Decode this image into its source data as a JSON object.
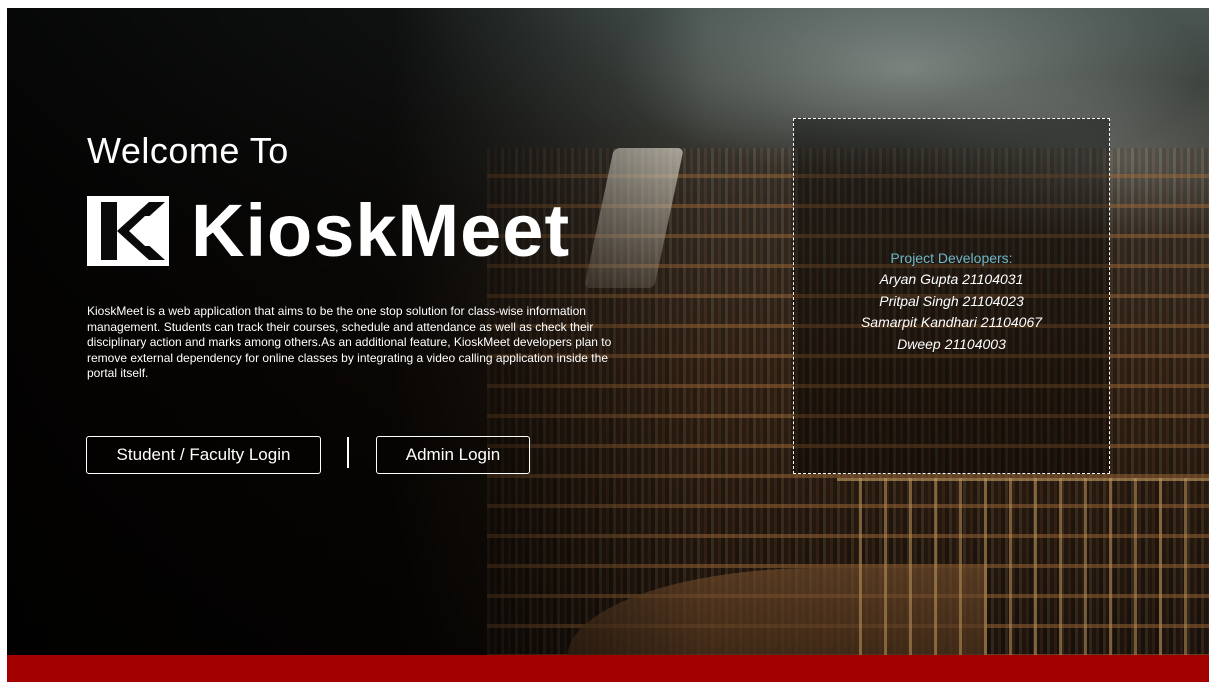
{
  "hero": {
    "welcome": "Welcome To",
    "brand_name": "KioskMeet",
    "description": "KioskMeet is a web application that aims to be the one stop solution for class-wise information management. Students can track their courses, schedule and attendance as well as check their disciplinary action and marks among others.As an additional feature, KioskMeet developers plan to remove external dependency for online classes by integrating a video calling application inside the portal itself."
  },
  "actions": {
    "student_login": "Student / Faculty Login",
    "admin_login": "Admin Login"
  },
  "developers": {
    "title": "Project Developers:",
    "names": [
      "Aryan Gupta 21104031",
      "Pritpal Singh 21104023",
      "Samarpit Kandhari 21104067",
      "Dweep 21104003"
    ]
  },
  "colors": {
    "footer": "#a30000",
    "developer_title": "#6fb6c6",
    "text": "#ffffff"
  },
  "icons": {
    "brand_logo": "kioskmeet-logo-icon"
  }
}
